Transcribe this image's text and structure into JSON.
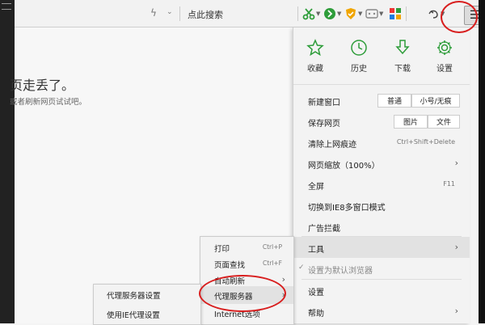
{
  "toolbar": {
    "search_label": "点此搜索",
    "menu_glyph": "☰"
  },
  "page": {
    "error_title": "页走丢了。",
    "error_subtitle": "或者刷新网页试试吧。"
  },
  "menu": {
    "quick": [
      {
        "label": "收藏",
        "icon": "star-icon"
      },
      {
        "label": "历史",
        "icon": "clock-icon"
      },
      {
        "label": "下载",
        "icon": "download-icon"
      },
      {
        "label": "设置",
        "icon": "gear-icon"
      }
    ],
    "new_window": {
      "label": "新建窗口",
      "btn1": "普通",
      "btn2": "小号/无痕"
    },
    "save_page": {
      "label": "保存网页",
      "btn1": "图片",
      "btn2": "文件"
    },
    "clear_traces": {
      "label": "清除上网痕迹",
      "shortcut": "Ctrl+Shift+Delete"
    },
    "zoom": {
      "label": "网页缩放（100%）",
      "arrow": "›"
    },
    "fullscreen": {
      "label": "全屏",
      "shortcut": "F11"
    },
    "ie8_mode": {
      "label": "切换到IE8多窗口模式"
    },
    "adblock": {
      "label": "广告拦截"
    },
    "tools": {
      "label": "工具",
      "arrow": "›"
    },
    "default_browser": {
      "label": "设置为默认浏览器",
      "check": "✓"
    },
    "settings": {
      "label": "设置"
    },
    "help": {
      "label": "帮助",
      "arrow": "›"
    }
  },
  "tools_submenu": {
    "items": [
      {
        "label": "打印",
        "shortcut": "Ctrl+P"
      },
      {
        "label": "页面查找",
        "shortcut": "Ctrl+F"
      },
      {
        "label": "自动刷新",
        "arrow": "›"
      },
      {
        "label": "代理服务器",
        "arrow": "›"
      },
      {
        "label": "Internet选项"
      }
    ]
  },
  "proxy_submenu": {
    "items": [
      {
        "label": "代理服务器设置"
      },
      {
        "label": "使用IE代理设置"
      }
    ]
  },
  "colors": {
    "accent_green": "#2e9d3a",
    "annotation_red": "#d81e1e"
  }
}
